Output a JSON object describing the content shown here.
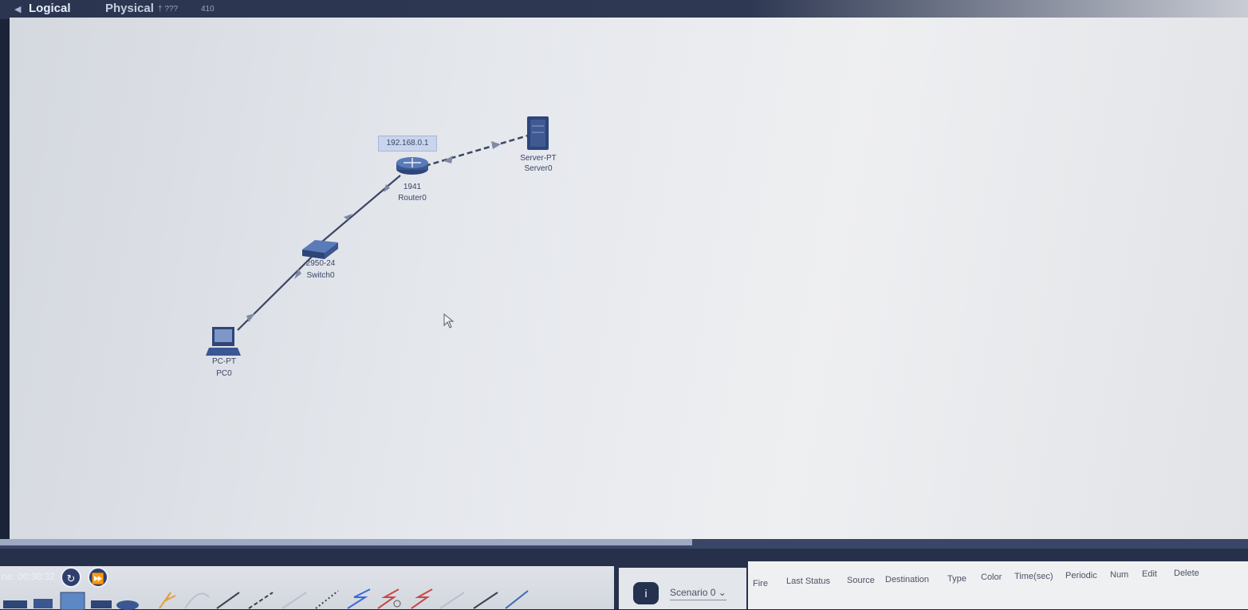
{
  "tabs": {
    "logical": "Logical",
    "physical": "Physical",
    "extra_1": "† ???",
    "extra_2": "410"
  },
  "topology": {
    "router": {
      "ip": "192.168.0.1",
      "model": "1941",
      "name": "Router0"
    },
    "server": {
      "model": "Server-PT",
      "name": "Server0"
    },
    "switch": {
      "model": "2950-24",
      "name": "Switch0"
    },
    "pc": {
      "model": "PC-PT",
      "name": "PC0"
    }
  },
  "simulation": {
    "time": "ne: 00:38:32",
    "scenario": "Scenario 0"
  },
  "pdu_columns": [
    "Fire",
    "Last Status",
    "Source",
    "Destination",
    "Type",
    "Color",
    "Time(sec)",
    "Periodic",
    "Num",
    "Edit",
    "Delete"
  ],
  "colors": {
    "link": "#3b4762",
    "link_arrow": "#7f8aa6",
    "device": "#3a4f86",
    "canvas": "#e4e7ec"
  },
  "icons": {
    "pc": "laptop-icon",
    "switch": "switch-icon",
    "router": "router-icon",
    "server": "server-icon"
  }
}
